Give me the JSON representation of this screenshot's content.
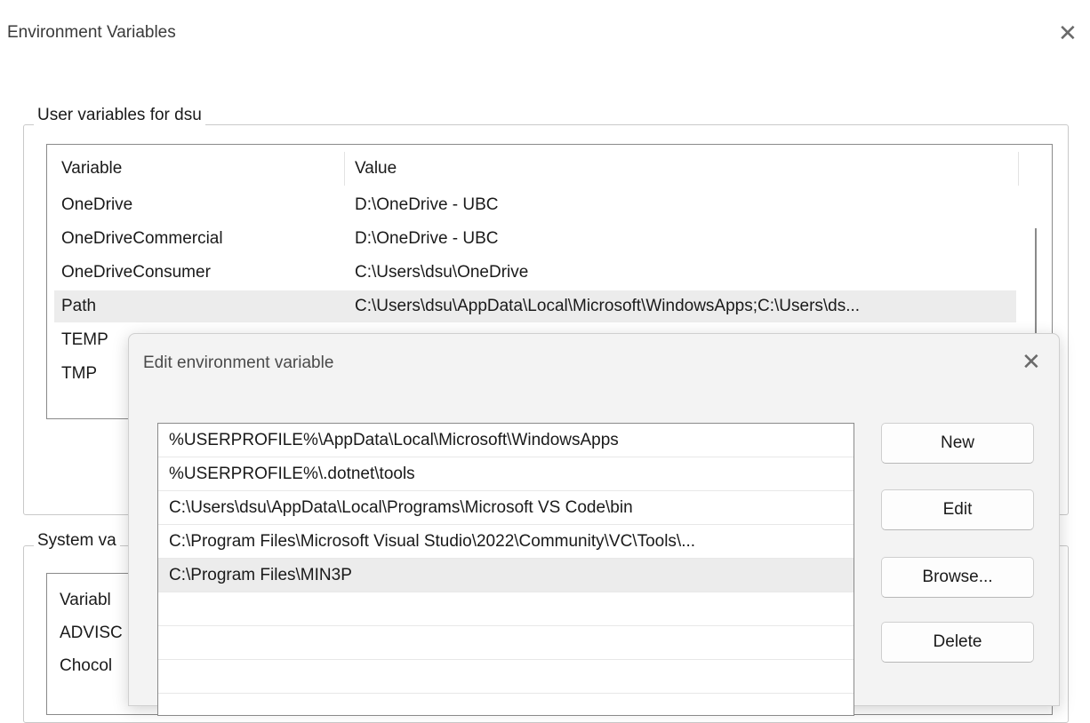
{
  "outer": {
    "title": "Environment Variables",
    "close_glyph": "✕",
    "user_group": {
      "legend": "User variables for dsu",
      "columns": [
        "Variable",
        "Value"
      ],
      "rows": [
        {
          "variable": "OneDrive",
          "value": "D:\\OneDrive - UBC"
        },
        {
          "variable": "OneDriveCommercial",
          "value": "D:\\OneDrive - UBC"
        },
        {
          "variable": "OneDriveConsumer",
          "value": "C:\\Users\\dsu\\OneDrive"
        },
        {
          "variable": "Path",
          "value": "C:\\Users\\dsu\\AppData\\Local\\Microsoft\\WindowsApps;C:\\Users\\ds..."
        },
        {
          "variable": "TEMP",
          "value": ""
        },
        {
          "variable": "TMP",
          "value": ""
        }
      ],
      "selected_row": 3
    },
    "system_group": {
      "legend_partial": "System va",
      "partial_rows": [
        "Variabl",
        "ADVISC",
        "Chocol"
      ]
    }
  },
  "edit_dialog": {
    "title": "Edit environment variable",
    "close_glyph": "✕",
    "entries": [
      "%USERPROFILE%\\AppData\\Local\\Microsoft\\WindowsApps",
      "%USERPROFILE%\\.dotnet\\tools",
      "C:\\Users\\dsu\\AppData\\Local\\Programs\\Microsoft VS Code\\bin",
      "C:\\Program Files\\Microsoft Visual Studio\\2022\\Community\\VC\\Tools\\...",
      "C:\\Program Files\\MIN3P",
      "",
      "",
      ""
    ],
    "selected_entry": 4,
    "buttons": {
      "new": "New",
      "edit": "Edit",
      "browse": "Browse...",
      "delete": "Delete"
    }
  }
}
